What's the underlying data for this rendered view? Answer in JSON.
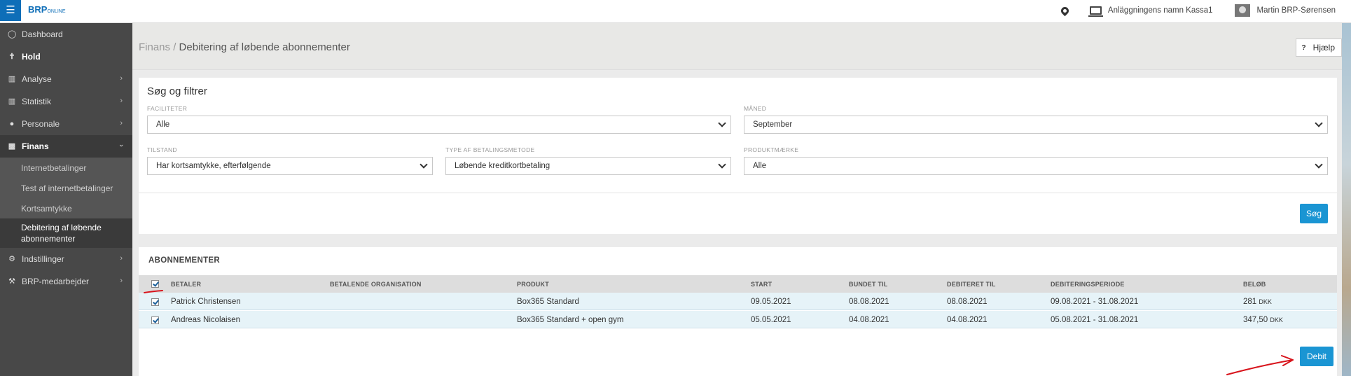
{
  "topbar": {
    "menu_icon": "hamburger-icon",
    "logo": "BRP",
    "logo_suffix": "ONLINE",
    "location_icon": "map-pin-icon",
    "register_icon": "cash-register-icon",
    "register_name": "Anläggningens namn Kassa1",
    "user_name": "Martin BRP-Sørensen"
  },
  "sidebar": {
    "items": [
      {
        "label": "Dashboard",
        "icon": "dashboard-icon"
      },
      {
        "label": "Hold",
        "icon": "person-icon"
      },
      {
        "label": "Analyse",
        "icon": "bar-chart-icon"
      },
      {
        "label": "Statistik",
        "icon": "bar-chart-icon"
      },
      {
        "label": "Personale",
        "icon": "user-icon"
      },
      {
        "label": "Finans",
        "icon": "money-icon"
      },
      {
        "label": "Indstillinger",
        "icon": "gear-icon"
      },
      {
        "label": "BRP-medarbejder",
        "icon": "wrench-icon"
      }
    ],
    "finans_sub": [
      {
        "label": "Internetbetalinger"
      },
      {
        "label": "Test af internetbetalinger"
      },
      {
        "label": "Kortsamtykke"
      },
      {
        "label_line1": "Debitering af løbende",
        "label_line2": "abonnementer"
      }
    ]
  },
  "header": {
    "breadcrumb_parent": "Finans",
    "breadcrumb_separator": " / ",
    "breadcrumb_current": "Debitering af løbende abonnementer",
    "help_icon": "?",
    "help_label": "Hjælp"
  },
  "filters": {
    "title": "Søg og filtrer",
    "faciliteter": {
      "label": "FACILITETER",
      "value": "Alle"
    },
    "maaned": {
      "label": "MÅNED",
      "value": "September"
    },
    "tilstand": {
      "label": "TILSTAND",
      "value": "Har kortsamtykke, efterfølgende"
    },
    "betalingsmetode": {
      "label": "TYPE AF BETALINGSMETODE",
      "value": "Løbende kreditkortbetaling"
    },
    "produktmaerke": {
      "label": "PRODUKTMÆRKE",
      "value": "Alle"
    },
    "search_button": "Søg"
  },
  "table": {
    "title": "ABONNEMENTER",
    "columns": [
      "BETALER",
      "BETALENDE ORGANISATION",
      "PRODUKT",
      "START",
      "BUNDET TIL",
      "DEBITERET TIL",
      "DEBITERINGSPERIODE",
      "BELØB"
    ],
    "header_checked": true,
    "rows": [
      {
        "checked": true,
        "betaler": "Patrick Christensen",
        "organisation": "",
        "produkt": "Box365 Standard",
        "start": "09.05.2021",
        "bundet_til": "08.08.2021",
        "debiteret_til": "08.08.2021",
        "periode": "09.08.2021 - 31.08.2021",
        "beloeb": "281",
        "valuta": "DKK"
      },
      {
        "checked": true,
        "betaler": "Andreas Nicolaisen",
        "organisation": "",
        "produkt": "Box365 Standard + open gym",
        "start": "05.05.2021",
        "bundet_til": "04.08.2021",
        "debiteret_til": "04.08.2021",
        "periode": "05.08.2021 - 31.08.2021",
        "beloeb": "347,50",
        "valuta": "DKK"
      }
    ],
    "debit_button": "Debit"
  },
  "annotation_color": "#d8141c"
}
